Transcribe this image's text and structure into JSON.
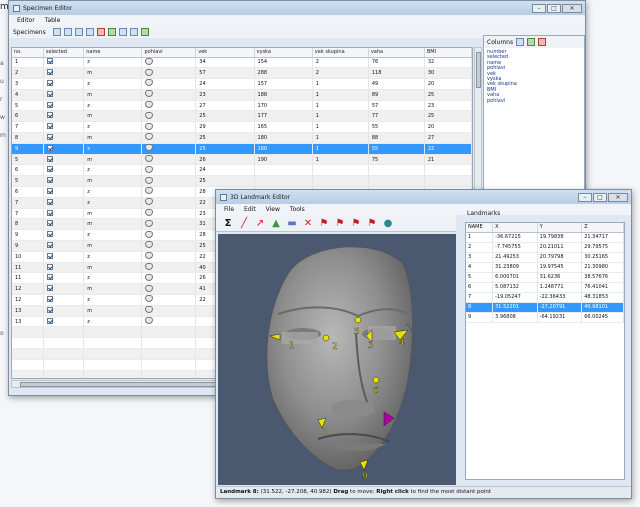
{
  "background": {
    "title_fragment": "m",
    "side_labels": [
      "a",
      "u",
      "r",
      "w",
      "m",
      "",
      "",
      "",
      "",
      "",
      "",
      "",
      "",
      "",
      "",
      "o",
      "",
      "",
      "",
      "",
      "",
      "",
      ""
    ]
  },
  "specimen_editor": {
    "title": "Specimen Editor",
    "menu": [
      "Editor",
      "Table"
    ],
    "specimens_label": "Specimens",
    "columns": [
      "no.",
      "selected",
      "name",
      "pohlavi",
      "vek",
      "vyska",
      "vek skupina",
      "vaha",
      "BMI"
    ],
    "rows": [
      [
        "1",
        "",
        "z",
        "",
        "34",
        "154",
        "2",
        "76",
        "32"
      ],
      [
        "2",
        "",
        "m",
        "",
        "57",
        "288",
        "2",
        "118",
        "30"
      ],
      [
        "3",
        "",
        "z",
        "",
        "24",
        "157",
        "1",
        "49",
        "20"
      ],
      [
        "4",
        "",
        "m",
        "",
        "23",
        "188",
        "1",
        "89",
        "25"
      ],
      [
        "5",
        "",
        "z",
        "",
        "27",
        "170",
        "1",
        "57",
        "23"
      ],
      [
        "6",
        "",
        "m",
        "",
        "25",
        "177",
        "1",
        "77",
        "25"
      ],
      [
        "7",
        "",
        "z",
        "",
        "29",
        "165",
        "1",
        "55",
        "20"
      ],
      [
        "8",
        "",
        "m",
        "",
        "25",
        "180",
        "1",
        "88",
        "27"
      ],
      [
        "9",
        "",
        "z",
        "",
        "25",
        "160",
        "1",
        "55",
        "22"
      ],
      [
        "5",
        "",
        "m",
        "",
        "26",
        "190",
        "1",
        "75",
        "21"
      ],
      [
        "6",
        "",
        "z",
        "",
        "24",
        "",
        "",
        "",
        ""
      ],
      [
        "5",
        "",
        "m",
        "",
        "25",
        "",
        "",
        "",
        ""
      ],
      [
        "6",
        "",
        "z",
        "",
        "28",
        "",
        "",
        "",
        ""
      ],
      [
        "7",
        "",
        "z",
        "",
        "22",
        "",
        "",
        "",
        ""
      ],
      [
        "7",
        "",
        "m",
        "",
        "23",
        "",
        "",
        "",
        ""
      ],
      [
        "8",
        "",
        "m",
        "",
        "31",
        "",
        "",
        "",
        ""
      ],
      [
        "9",
        "",
        "z",
        "",
        "28",
        "",
        "",
        "",
        ""
      ],
      [
        "9",
        "",
        "m",
        "",
        "25",
        "",
        "",
        "",
        ""
      ],
      [
        "10",
        "",
        "z",
        "",
        "22",
        "",
        "",
        "",
        ""
      ],
      [
        "11",
        "",
        "m",
        "",
        "40",
        "",
        "",
        "",
        ""
      ],
      [
        "11",
        "",
        "z",
        "",
        "26",
        "",
        "",
        "",
        ""
      ],
      [
        "12",
        "",
        "m",
        "",
        "41",
        "",
        "",
        "",
        ""
      ],
      [
        "12",
        "",
        "z",
        "",
        "22",
        "",
        "",
        "",
        ""
      ],
      [
        "13",
        "",
        "m",
        "",
        "",
        "",
        "",
        "",
        ""
      ],
      [
        "13",
        "",
        "z",
        "",
        "",
        "",
        "",
        "",
        ""
      ],
      [
        "",
        "",
        "",
        "",
        "",
        "",
        "",
        "",
        ""
      ],
      [
        "",
        "",
        "",
        "",
        "",
        "",
        "",
        "",
        ""
      ],
      [
        "",
        "",
        "",
        "",
        "",
        "",
        "",
        "",
        ""
      ],
      [
        "",
        "",
        "",
        "",
        "",
        "",
        "",
        "",
        ""
      ],
      [
        "",
        "",
        "",
        "",
        "",
        "",
        "",
        "",
        ""
      ]
    ],
    "selected_row_index": 8,
    "columns_panel_label": "Columns",
    "columns_panel_items": [
      "number",
      "selected",
      "name",
      "pohlavi",
      "vek",
      "vyska",
      "vek skupina",
      "BMI",
      "vaha",
      "pohlavi"
    ]
  },
  "landmark_editor": {
    "title": "3D Landmark Editor",
    "menu": [
      "File",
      "Edit",
      "View",
      "Tools"
    ],
    "toolbar_icons": [
      "sigma-icon",
      "line-icon",
      "arrow-icon",
      "triangle-icon",
      "plane-icon",
      "delete-icon",
      "flag-icon",
      "flag2-icon",
      "flag3-icon",
      "flag4-icon",
      "brain-icon"
    ],
    "landmarks_label": "Landmarks",
    "table_columns": [
      "NAME",
      "X",
      "Y",
      "Z"
    ],
    "table_rows": [
      [
        "1",
        "-36.67215",
        "19.79838",
        "21.34717"
      ],
      [
        "2",
        "-7.745755",
        "20.21011",
        "29.79575"
      ],
      [
        "3",
        "21.49253",
        "20.79798",
        "30.25165"
      ],
      [
        "4",
        "31.23809",
        "19.97545",
        "21.30980"
      ],
      [
        "5",
        "6.000701",
        "31.6236",
        "38.57676"
      ],
      [
        "6",
        "5.087132",
        "1.248771",
        "76.41041"
      ],
      [
        "7",
        "-19.05247",
        "-22.36433",
        "48.31853"
      ],
      [
        "8",
        "31.52201",
        "-27.20791",
        "40.98101"
      ],
      [
        "9",
        "3.96808",
        "-64.19231",
        "66.00245"
      ]
    ],
    "selected_landmark_index": 7,
    "markers": [
      "1",
      "2",
      "3",
      "4",
      "5",
      "6",
      "7",
      "8",
      "9"
    ],
    "status": {
      "landmark": "Landmark 8:",
      "coords": "(31.522, -27.208, 40.982)",
      "drag_key": "Drag",
      "drag_text": "to move;",
      "click_key": "Right click",
      "click_text": "to find the most distant point"
    },
    "colors": {
      "marker": "#e8e000",
      "selected_marker": "#b000a0",
      "viewport_bg": "#4a5870"
    }
  }
}
